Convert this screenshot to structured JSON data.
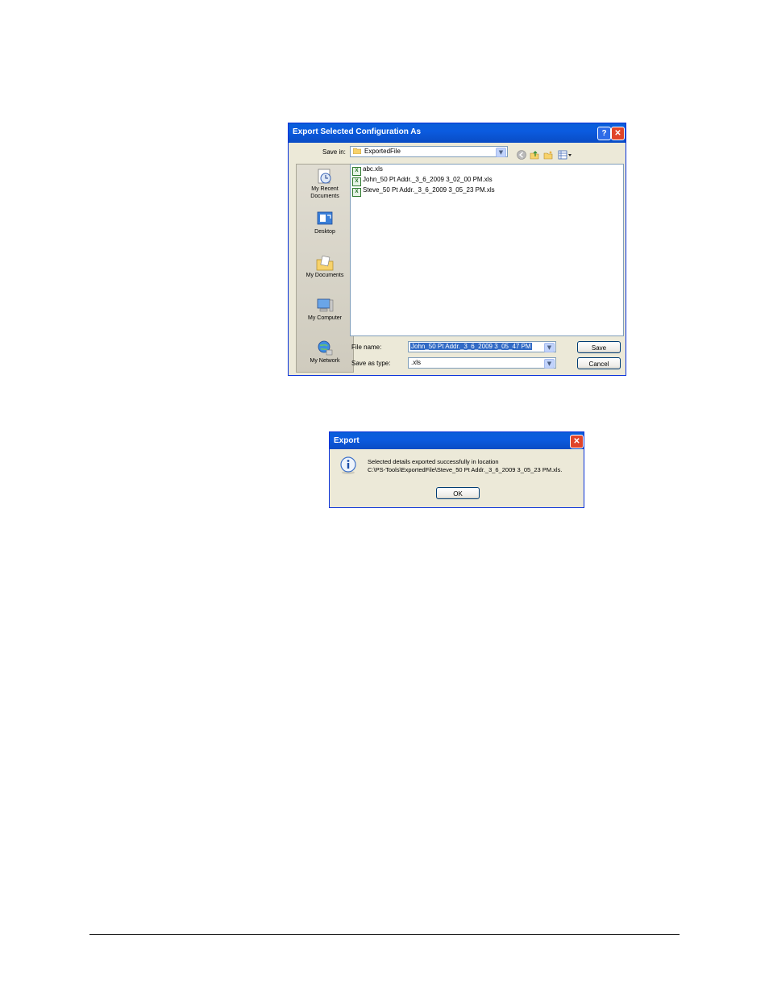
{
  "save_dialog": {
    "title": "Export Selected Configuration As",
    "help_glyph": "?",
    "close_glyph": "✕",
    "save_in_label": "Save in:",
    "save_in_value": "ExportedFile",
    "places": [
      {
        "label": "My Recent Documents",
        "icon": "recent-documents-icon"
      },
      {
        "label": "Desktop",
        "icon": "desktop-icon"
      },
      {
        "label": "My Documents",
        "icon": "my-documents-icon"
      },
      {
        "label": "My Computer",
        "icon": "my-computer-icon"
      },
      {
        "label": "My Network",
        "icon": "my-network-icon"
      }
    ],
    "files": [
      "abc.xls",
      "John_50 Pt Addr._3_6_2009 3_02_00 PM.xls",
      "Steve_50 Pt Addr._3_6_2009 3_05_23 PM.xls"
    ],
    "file_name_label": "File name:",
    "file_name_value": "John_50 Pt Addr._3_6_2009 3_05_47 PM",
    "save_as_type_label": "Save as type:",
    "save_as_type_value": ".xls",
    "save_button": "Save",
    "cancel_button": "Cancel"
  },
  "message_box": {
    "title": "Export",
    "close_glyph": "✕",
    "line1": "Selected details exported successfully in location",
    "line2": "C:\\PS-Tools\\ExportedFile\\Steve_50 Pt Addr._3_6_2009 3_05_23 PM.xls.",
    "ok_button": "OK"
  },
  "colors": {
    "titlebar": "#0a5fd8",
    "dialog_face": "#ece9d8",
    "close_red": "#e0452a",
    "selection": "#316ac5"
  }
}
